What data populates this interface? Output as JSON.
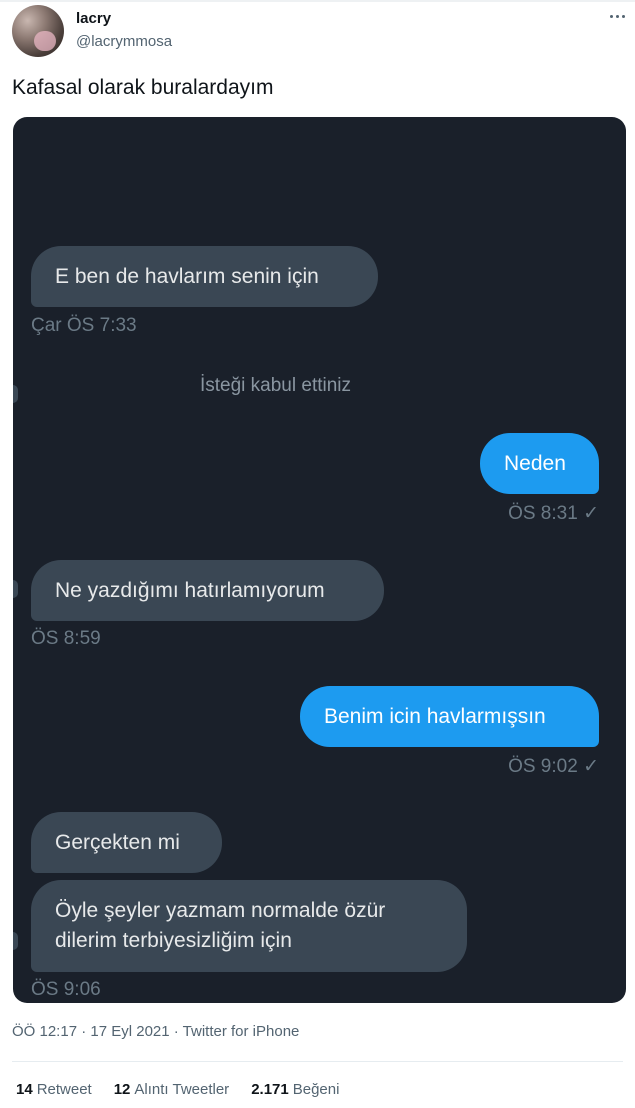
{
  "author": {
    "name": "lacry",
    "handle": "@lacrymmosa"
  },
  "tweet": {
    "text": "Kafasal olarak buralardayım"
  },
  "chat": {
    "messages": [
      {
        "text": "E ben de havlarım senin için"
      },
      {
        "meta": "Çar ÖS 7:33"
      },
      {
        "system": "İsteği kabul ettiniz"
      },
      {
        "text": "Neden"
      },
      {
        "meta": "ÖS 8:31 ✓"
      },
      {
        "text": "Ne yazdığımı hatırlamıyorum"
      },
      {
        "meta": "ÖS 8:59"
      },
      {
        "text": "Benim icin havlarmışsın"
      },
      {
        "meta": "ÖS 9:02 ✓"
      },
      {
        "text": "Gerçekten mi"
      },
      {
        "text": "Öyle şeyler yazmam normalde özür dilerim terbiyesizliğim için"
      },
      {
        "meta": "ÖS 9:06"
      }
    ]
  },
  "footer": {
    "timestamp": "ÖÖ 12:17 · 17 Eyl 2021 · Twitter for iPhone",
    "retweets": {
      "count": "14",
      "label": "Retweet"
    },
    "quotes": {
      "count": "12",
      "label": "Alıntı Tweetler"
    },
    "likes": {
      "count": "2.171",
      "label": "Beğeni"
    }
  }
}
